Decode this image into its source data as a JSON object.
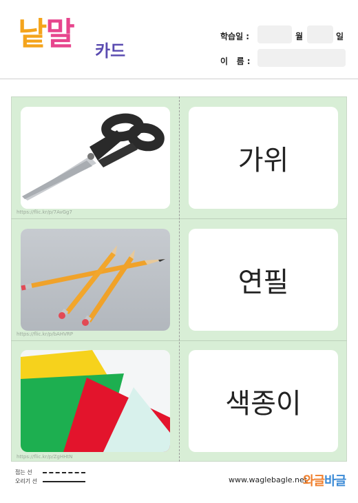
{
  "header": {
    "logo_main_1": "낱",
    "logo_main_2": "말",
    "logo_sub": "카드",
    "date_label": "학습일 :",
    "month_label": "월",
    "day_label": "일",
    "name_label": "이   름 :"
  },
  "cards": [
    {
      "image": "scissors",
      "word": "가위",
      "credit": "https://flic.kr/p/7AvGg7"
    },
    {
      "image": "pencils",
      "word": "연필",
      "credit": "https://flic.kr/p/bAHVRP"
    },
    {
      "image": "colored-paper",
      "word": "색종이",
      "credit": "https://flic.kr/p/ZgHHtN"
    }
  ],
  "footer": {
    "fold_label": "접는 선",
    "cut_label": "오리기 선",
    "website": "www.waglebagle.net",
    "brand_1": "와글",
    "brand_2": "바글"
  },
  "colors": {
    "board": "#d8eed6",
    "logo_orange": "#f4a41c",
    "logo_pink": "#e7458d",
    "logo_purple": "#5a4bb0"
  }
}
